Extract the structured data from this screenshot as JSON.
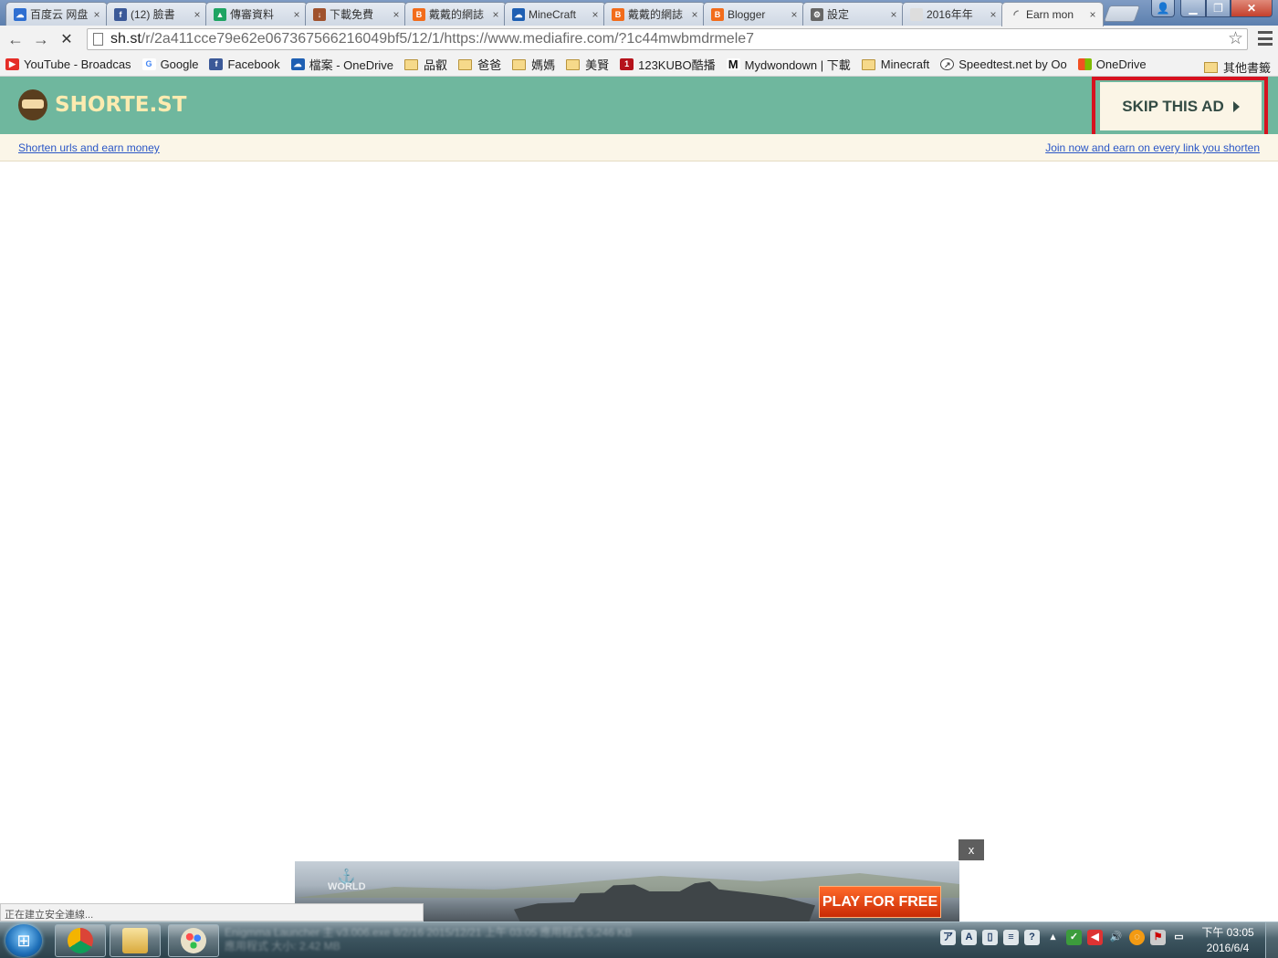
{
  "tabs": [
    {
      "title": "百度云 网盘",
      "icon": "baidu-cloud-icon",
      "color": "#2f6fd1",
      "close": "×"
    },
    {
      "title": "(12) 臉書",
      "icon": "facebook-icon",
      "color": "#3b5998",
      "close": "×"
    },
    {
      "title": "傳審資料",
      "icon": "google-drive-icon",
      "color": "#1fa463",
      "close": "×"
    },
    {
      "title": "下載免費",
      "icon": "download-page-icon",
      "color": "#a0522d",
      "close": "×"
    },
    {
      "title": "戴戴的網誌",
      "icon": "blogger-icon",
      "color": "#f26c1b",
      "close": "×"
    },
    {
      "title": "MineCraft",
      "icon": "onedrive-icon",
      "color": "#1e5fb3",
      "close": "×"
    },
    {
      "title": "戴戴的網誌",
      "icon": "blogger-icon",
      "color": "#f26c1b",
      "close": "×"
    },
    {
      "title": "Blogger",
      "icon": "blogger-icon",
      "color": "#f26c1b",
      "close": "×"
    },
    {
      "title": "設定",
      "icon": "gear-icon",
      "color": "#666666",
      "close": "×"
    },
    {
      "title": "2016年年",
      "icon": "blank-page-icon",
      "color": "#dddddd",
      "close": "×"
    },
    {
      "title": "Earn mon",
      "icon": "loading-spinner-icon",
      "color": "#777777",
      "close": "×"
    }
  ],
  "window": {
    "user_glyph": "👤",
    "min_glyph": "▁",
    "max_glyph": "❐",
    "close_glyph": "✕"
  },
  "toolbar": {
    "back_glyph": "←",
    "forward_glyph": "→",
    "stop_glyph": "✕",
    "url_host": "sh.st",
    "url_path": "/r/2a411cce79e62e067367566216049bf5/12/1/https://www.mediafire.com/?1c44mwbmdrmele7",
    "star_glyph": "☆"
  },
  "bookmarks": [
    {
      "label": "YouTube - Broadcas",
      "icon": "youtube-icon",
      "color": "#e52d27"
    },
    {
      "label": "Google",
      "icon": "google-icon",
      "color": "#4285f4"
    },
    {
      "label": "Facebook",
      "icon": "facebook-icon",
      "color": "#3b5998"
    },
    {
      "label": "檔案 - OneDrive",
      "icon": "onedrive-icon",
      "color": "#1e5fb3"
    },
    {
      "label": "品叡",
      "icon": "folder-icon",
      "color": ""
    },
    {
      "label": "爸爸",
      "icon": "folder-icon",
      "color": ""
    },
    {
      "label": "媽媽",
      "icon": "folder-icon",
      "color": ""
    },
    {
      "label": "美賢",
      "icon": "folder-icon",
      "color": ""
    },
    {
      "label": "123KUBO酷播",
      "icon": "kubo-icon",
      "color": "#b5121b"
    },
    {
      "label": "Mydwondown | 下載",
      "icon": "m-logo-icon",
      "color": "#111111"
    },
    {
      "label": "Minecraft",
      "icon": "folder-icon",
      "color": ""
    },
    {
      "label": "Speedtest.net by Oo",
      "icon": "speedometer-icon",
      "color": "#444444"
    },
    {
      "label": "OneDrive",
      "icon": "windows-logo-icon",
      "color": "#f25022"
    }
  ],
  "bookmarks_other": "其他書籤",
  "shortest": {
    "logo_text": "SHORTE.ST",
    "skip_label": "SKIP THIS AD",
    "left_link": "Shorten urls and earn money",
    "right_link": "Join now and earn on every link you shorten"
  },
  "ad": {
    "close_label": "x",
    "logo_line1": "⚓",
    "logo_line2": "WORLD",
    "cta": "PLAY FOR FREE"
  },
  "status_text": "正在建立安全連線...",
  "taskbar": {
    "start_glyph": "⊞",
    "blurred_line1": "Enigmma Launcher 主 v3.006.exe   8/2/16   2015/12/21 上午 03:05   應用程式   5,246 KB",
    "blurred_line2": "應用程式                                      大小: 2.42 MB",
    "clock_time": "下午 03:05",
    "clock_date": "2016/6/4"
  },
  "colors": {
    "header_green": "#6fb79e",
    "skip_highlight": "#d6121f",
    "link_blue": "#2a56c6"
  }
}
